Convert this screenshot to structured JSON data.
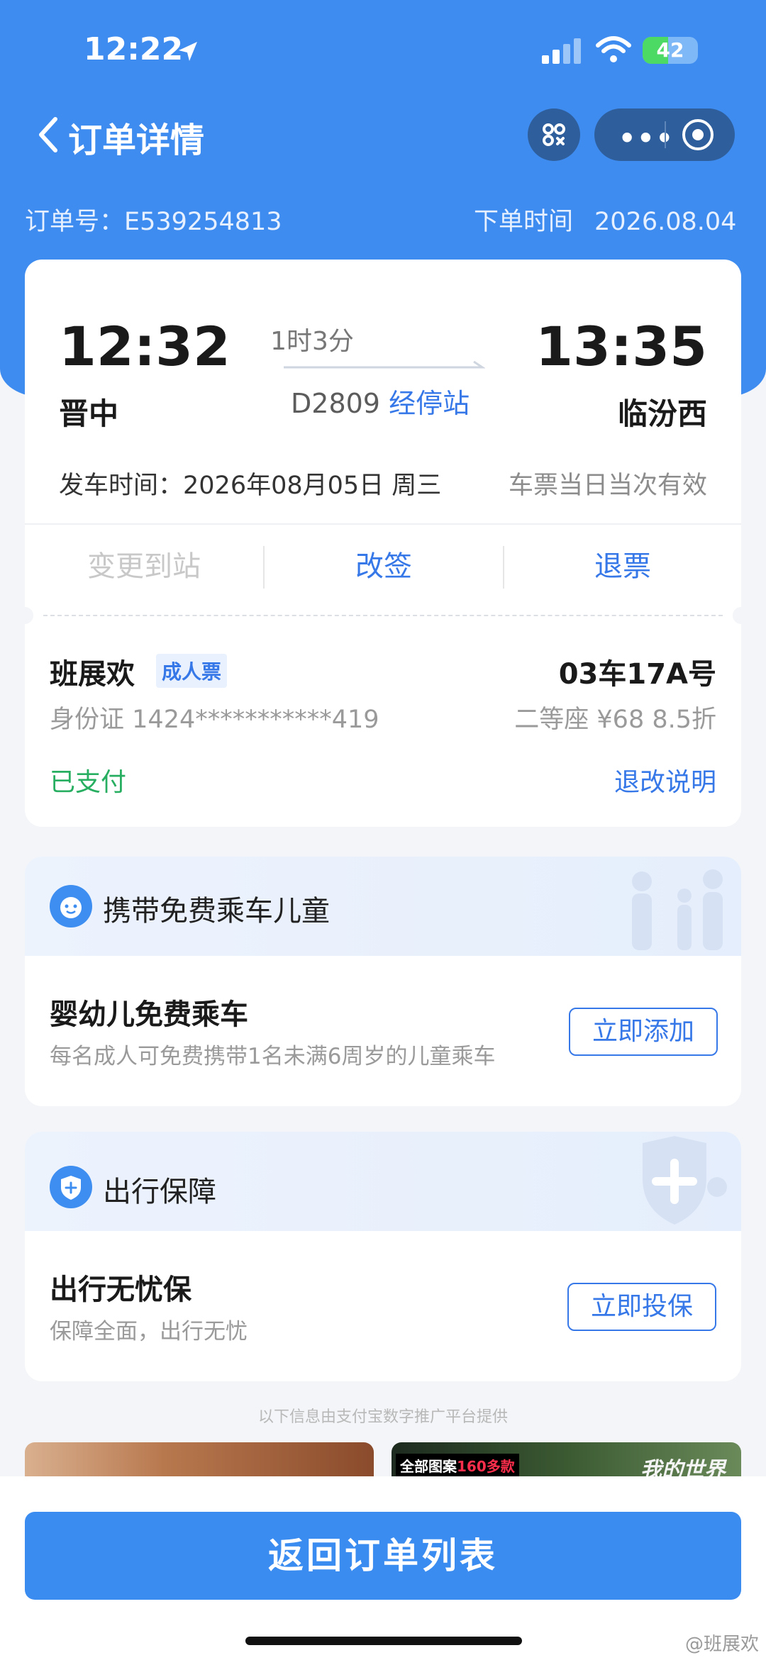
{
  "status_bar": {
    "time": "12:22",
    "battery": "42"
  },
  "nav": {
    "title": "订单详情"
  },
  "order": {
    "number_label": "订单号：",
    "number": "E539254813",
    "time_label": "下单时间",
    "time": "2026.08.04"
  },
  "trip": {
    "depart_time": "12:32",
    "depart_station": "晋中",
    "duration": "1时3分",
    "train_no": "D2809",
    "stops_link": "经停站",
    "arrive_time": "13:35",
    "arrive_station": "临汾西",
    "date_label": "发车时间：",
    "date": "2026年08月05日 周三",
    "validity": "车票当日当次有效"
  },
  "actions": {
    "change_station": "变更到站",
    "reschedule": "改签",
    "refund": "退票"
  },
  "passenger": {
    "name": "班展欢",
    "ticket_type": "成人票",
    "seat": "03车17A号",
    "id_label": "身份证",
    "id_number": "1424***********419",
    "seat_class": "二等座 ¥68 8.5折",
    "status": "已支付",
    "refund_info": "退改说明"
  },
  "child_section": {
    "title": "携带免费乘车儿童",
    "item_title": "婴幼儿免费乘车",
    "item_desc": "每名成人可免费携带1名未满6周岁的儿童乘车",
    "button": "立即添加"
  },
  "insurance_section": {
    "title": "出行保障",
    "item_title": "出行无忧保",
    "item_desc": "保障全面，出行无忧",
    "button": "立即投保"
  },
  "ad": {
    "notice": "以下信息由支付宝数字推广平台提供",
    "right_banner_prefix": "全部图案",
    "right_banner_highlight": "160多款",
    "right_banner_title": "我的世界"
  },
  "footer": {
    "return_button": "返回订单列表",
    "watermark": "@班展欢"
  },
  "colors": {
    "brand_blue": "#3f8cf0",
    "link_blue": "#3778e8",
    "paid_green": "#27ae60"
  }
}
